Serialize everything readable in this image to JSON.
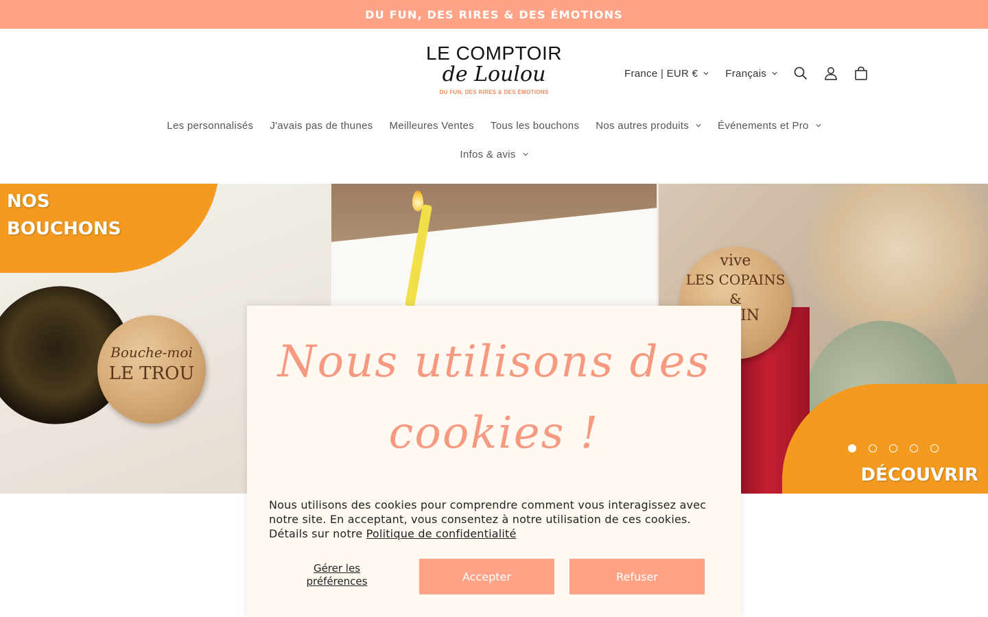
{
  "announcement": {
    "text": "DU FUN, DES RIRES & DES ÉMOTIONS"
  },
  "logo": {
    "line1": "LE COMPTOIR",
    "line2": "de Loulou",
    "tagline": "DU FUN, DES RIRES & DES ÉMOTIONS"
  },
  "header": {
    "country_selector": "France | EUR €",
    "language_selector": "Français",
    "icons": [
      "search-icon",
      "account-icon",
      "cart-icon"
    ]
  },
  "nav": {
    "items": [
      {
        "label": "Les personnalisés",
        "has_dropdown": false
      },
      {
        "label": "J'avais pas de thunes",
        "has_dropdown": false
      },
      {
        "label": "Meilleures Ventes",
        "has_dropdown": false
      },
      {
        "label": "Tous les bouchons",
        "has_dropdown": false
      },
      {
        "label": "Nos autres produits",
        "has_dropdown": true
      },
      {
        "label": "Événements et Pro",
        "has_dropdown": true
      },
      {
        "label": "Infos & avis",
        "has_dropdown": true
      }
    ]
  },
  "banner": {
    "title_line1": "NOS",
    "title_line2": "BOUCHONS",
    "cta": "DÉCOUVRIR",
    "cork1_line1": "Bouche-moi",
    "cork1_line2": "LE TROU",
    "cork3_line1": "vive",
    "cork3_line2": "LES COPAINS",
    "cork3_line3": "&",
    "cork3_line4": "N VIN",
    "slides_total": 5,
    "active_slide": 1,
    "accent_color": "#f39a1f"
  },
  "cookie": {
    "title": "Nous utilisons des cookies !",
    "body": "Nous utilisons des cookies pour comprendre comment vous interagissez avec notre site. En acceptant, vous consentez à notre utilisation de ces cookies. Détails sur notre ",
    "link": "Politique de confidentialité",
    "prefs_label": "Gérer les préférences",
    "accept_label": "Accepter",
    "refuse_label": "Refuser",
    "accent_color": "#ffa285"
  }
}
